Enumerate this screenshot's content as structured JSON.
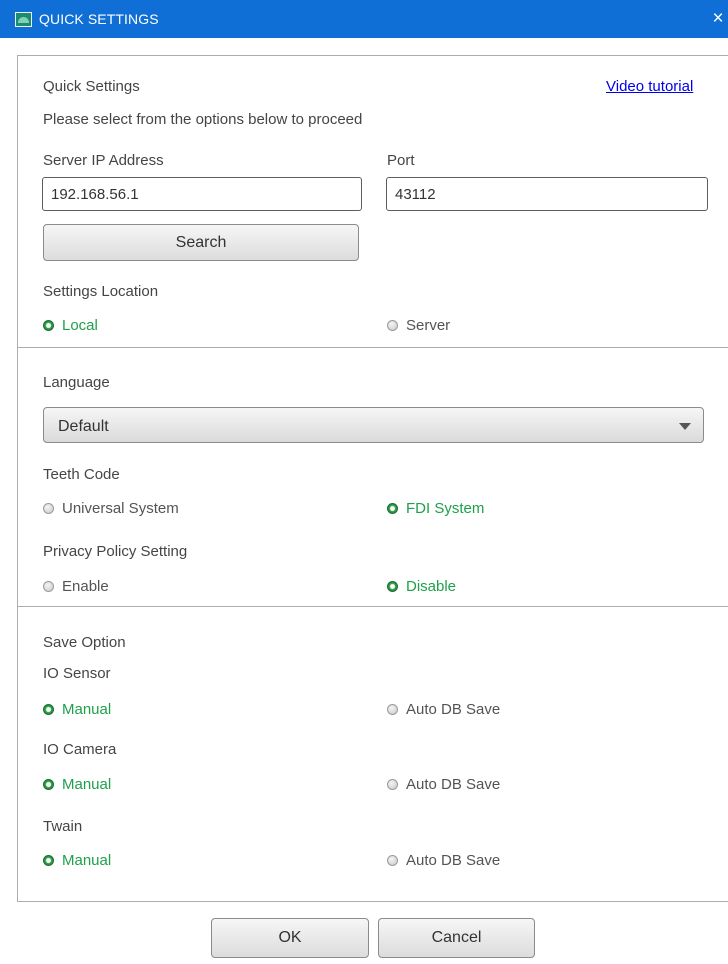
{
  "window": {
    "title": "QUICK SETTINGS",
    "close_glyph": "×",
    "icon": "app-icon"
  },
  "header": {
    "title": "Quick Settings",
    "subtitle": "Please select from the options below to proceed",
    "video_link": "Video tutorial"
  },
  "server": {
    "ip_label": "Server IP Address",
    "ip_value": "192.168.56.1",
    "port_label": "Port",
    "port_value": "43112",
    "search_button": "Search"
  },
  "settings_location": {
    "label": "Settings Location",
    "options": [
      {
        "label": "Local",
        "selected": true
      },
      {
        "label": "Server",
        "selected": false
      }
    ]
  },
  "language": {
    "label": "Language",
    "selected": "Default"
  },
  "teeth_code": {
    "label": "Teeth Code",
    "options": [
      {
        "label": "Universal System",
        "selected": false
      },
      {
        "label": "FDI System",
        "selected": true
      }
    ]
  },
  "privacy": {
    "label": "Privacy Policy Setting",
    "options": [
      {
        "label": "Enable",
        "selected": false
      },
      {
        "label": "Disable",
        "selected": true
      }
    ]
  },
  "save_option": {
    "label": "Save Option",
    "groups": [
      {
        "label": "IO Sensor",
        "options": [
          {
            "label": "Manual",
            "selected": true
          },
          {
            "label": "Auto DB Save",
            "selected": false
          }
        ]
      },
      {
        "label": "IO Camera",
        "options": [
          {
            "label": "Manual",
            "selected": true
          },
          {
            "label": "Auto DB Save",
            "selected": false
          }
        ]
      },
      {
        "label": "Twain",
        "options": [
          {
            "label": "Manual",
            "selected": true
          },
          {
            "label": "Auto DB Save",
            "selected": false
          }
        ]
      }
    ]
  },
  "footer": {
    "ok": "OK",
    "cancel": "Cancel"
  },
  "colors": {
    "titlebar": "#0f6fd6",
    "selected_text": "#1fa04a",
    "radio_selected": "#2aa147",
    "link": "#0000ee"
  }
}
